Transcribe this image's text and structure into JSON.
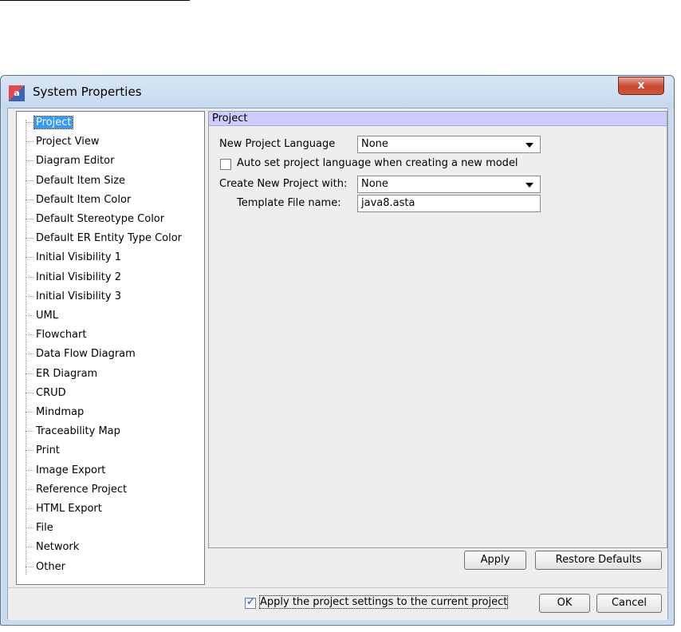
{
  "window": {
    "title": "System Properties",
    "icon": "astah-app-icon",
    "close_label": "x"
  },
  "tree": {
    "items": [
      "Project",
      "Project View",
      "Diagram Editor",
      "Default Item Size",
      "Default Item Color",
      "Default Stereotype Color",
      "Default ER Entity Type Color",
      "Initial Visibility 1",
      "Initial Visibility 2",
      "Initial Visibility 3",
      "UML",
      "Flowchart",
      "Data Flow Diagram",
      "ER Diagram",
      "CRUD",
      "Mindmap",
      "Traceability Map",
      "Print",
      "Image Export",
      "Reference Project",
      "HTML Export",
      "File",
      "Network",
      "Other"
    ],
    "selected": "Project"
  },
  "panel": {
    "header": "Project",
    "new_project_language_label": "New Project Language",
    "new_project_language_value": "None",
    "auto_set_label": "Auto set project language when creating a new model",
    "auto_set_checked": false,
    "create_with_label": "Create New Project with:",
    "create_with_value": "None",
    "template_label": "Template File name:",
    "template_value": "java8.asta",
    "apply_label": "Apply",
    "restore_label": "Restore Defaults"
  },
  "footer": {
    "apply_current_label": "Apply the project settings to the current project",
    "apply_current_checked": true,
    "ok_label": "OK",
    "cancel_label": "Cancel"
  }
}
